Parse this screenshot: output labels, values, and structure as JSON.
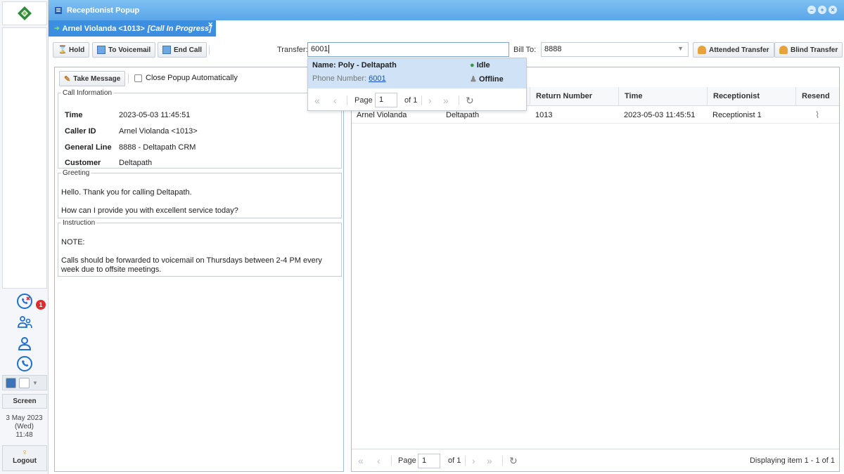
{
  "sidebar": {
    "missed_badge": "1",
    "screen_label": "Screen",
    "date_line1": "3 May 2023",
    "date_line2": "(Wed)",
    "date_line3": "11:48",
    "logout_label": "Logout"
  },
  "window": {
    "title": "Receptionist Popup"
  },
  "call_tab": {
    "caller": "Arnel Violanda <1013>",
    "status": "[Call In Progress]"
  },
  "toolbar": {
    "hold_label": "Hold",
    "voicemail_label": "To Voicemail",
    "endcall_label": "End Call",
    "transfer_label": "Transfer:",
    "transfer_value": "6001",
    "billto_label": "Bill To:",
    "billto_value": "8888",
    "attended_label": "Attended Transfer",
    "blind_label": "Blind Transfer"
  },
  "dropdown": {
    "name_label": "Name:",
    "name_value": "Poly - Deltapath",
    "idle_label": "Idle",
    "phone_label": "Phone Number:",
    "phone_value": "6001",
    "offline_label": "Offline",
    "page_label": "Page",
    "page_value": "1",
    "of_label": "of 1"
  },
  "left": {
    "take_message_label": "Take Message",
    "close_popup_label": "Close Popup Automatically",
    "call_info_legend": "Call Information",
    "time_key": "Time",
    "time_value": "2023-05-03 11:45:51",
    "callerid_key": "Caller ID",
    "callerid_value": "Arnel Violanda <1013>",
    "genline_key": "General Line",
    "genline_value": "8888 - Deltapath CRM",
    "customer_key": "Customer",
    "customer_value": "Deltapath",
    "greeting_legend": "Greeting",
    "greeting_line1": "Hello. Thank you for calling Deltapath.",
    "greeting_line2": "How can I provide you with excellent service today?",
    "instruction_legend": "Instruction",
    "instruction_line1": "NOTE:",
    "instruction_line2": "Calls should be forwarded to voicemail on Thursdays between 2-4 PM every week due to offsite meetings."
  },
  "grid": {
    "columns": [
      "Return Number",
      "Time",
      "Receptionist",
      "Resend"
    ],
    "rows": [
      {
        "caller": "Arnel Violanda",
        "company": "Deltapath",
        "return_number": "1013",
        "time": "2023-05-03 11:45:51",
        "receptionist": "Receptionist 1"
      }
    ],
    "page_label": "Page",
    "page_value": "1",
    "of_label": "of 1",
    "display_text": "Displaying item 1 - 1 of 1"
  },
  "colors": {
    "titlebar": "#5aa6e9",
    "call_tab": "#3c8fe0",
    "badge": "#e32b2b",
    "selection": "#cfe2f6"
  }
}
